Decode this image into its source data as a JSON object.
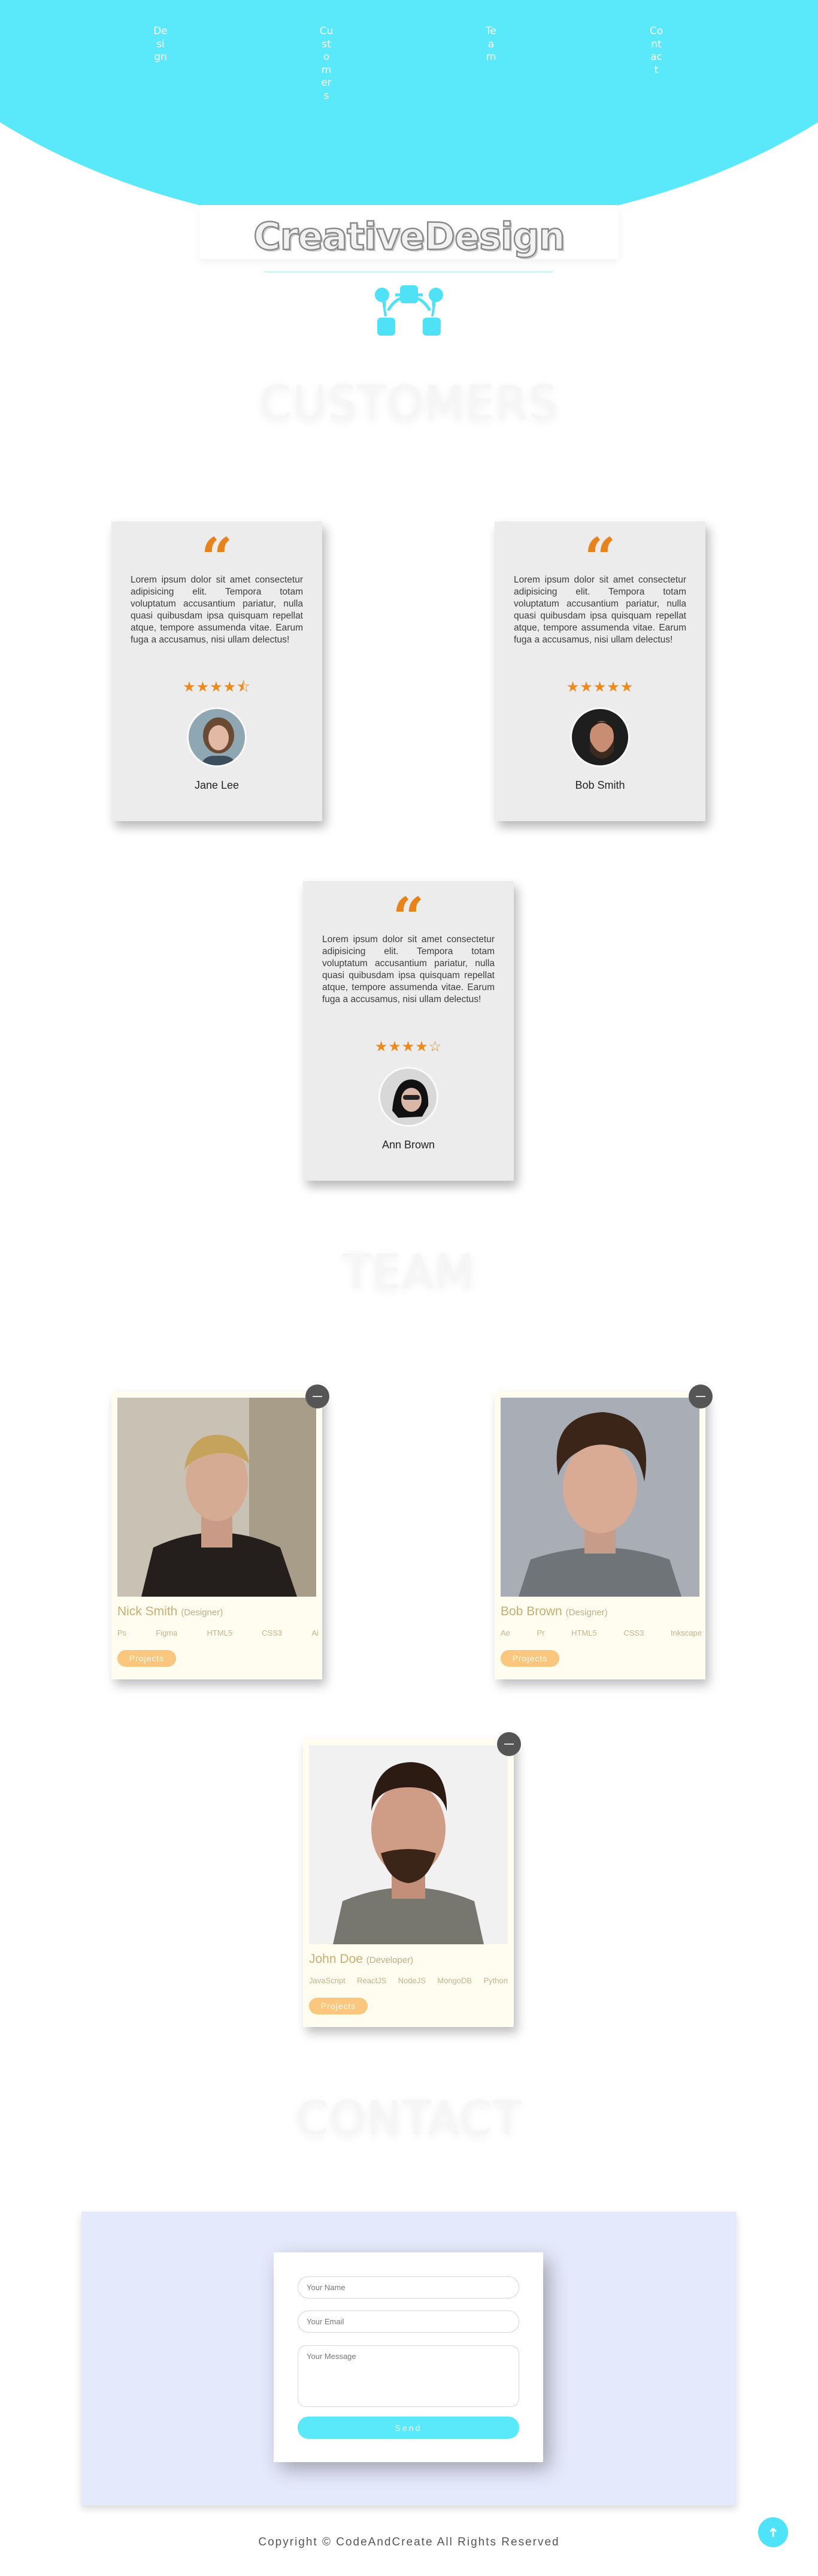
{
  "nav": {
    "items": [
      {
        "label": "Design"
      },
      {
        "label": "Customers"
      },
      {
        "label": "Team"
      },
      {
        "label": "Contact"
      }
    ]
  },
  "banner": {
    "title": "CreativeDesign",
    "logo_icon": "connected-nodes-icon"
  },
  "sections": {
    "customers": "CUSTOMERS",
    "team": "TEAM",
    "contact": "CONTACT"
  },
  "testimonials": [
    {
      "text": "Lorem ipsum dolor sit amet consectetur adipisicing elit. Tempora totam voluptatum accusantium pariatur, nulla quasi quibusdam ipsa quisquam repellat atque, tempore assumenda vitae. Earum fuga a accusamus, nisi ullam delectus!",
      "rating": 4.5,
      "stars": "★★★★⯪",
      "name": "Jane Lee"
    },
    {
      "text": "Lorem ipsum dolor sit amet consectetur adipisicing elit. Tempora totam voluptatum accusantium pariatur, nulla quasi quibusdam ipsa quisquam repellat atque, tempore assumenda vitae. Earum fuga a accusamus, nisi ullam delectus!",
      "rating": 5,
      "stars": "★★★★★",
      "name": "Bob Smith"
    },
    {
      "text": "Lorem ipsum dolor sit amet consectetur adipisicing elit. Tempora totam voluptatum accusantium pariatur, nulla quasi quibusdam ipsa quisquam repellat atque, tempore assumenda vitae. Earum fuga a accusamus, nisi ullam delectus!",
      "rating": 4,
      "stars": "★★★★☆",
      "name": "Ann Brown"
    }
  ],
  "team": [
    {
      "name": "Nick Smith",
      "role": "(Designer)",
      "skills": [
        "Ps",
        "Figma",
        "HTML5",
        "CSS3",
        "Ai"
      ],
      "button": "Projects"
    },
    {
      "name": "Bob Brown",
      "role": "(Designer)",
      "skills": [
        "Ae",
        "Pr",
        "HTML5",
        "CSS3",
        "Inkscape"
      ],
      "button": "Projects"
    },
    {
      "name": "John Doe",
      "role": "(Developer)",
      "skills": [
        "JavaScript",
        "ReactJS",
        "NodeJS",
        "MongoDB",
        "Python"
      ],
      "button": "Projects"
    }
  ],
  "contact_form": {
    "name_placeholder": "Your Name",
    "email_placeholder": "Your Email",
    "message_placeholder": "Your Message",
    "send_label": "Send"
  },
  "footer": {
    "text": "Copyright © CodeAndCreate All Rights Reserved"
  },
  "colors": {
    "accent": "#5ae8fb",
    "star": "#ee8a1c",
    "projects_button": "#fbc67d"
  }
}
